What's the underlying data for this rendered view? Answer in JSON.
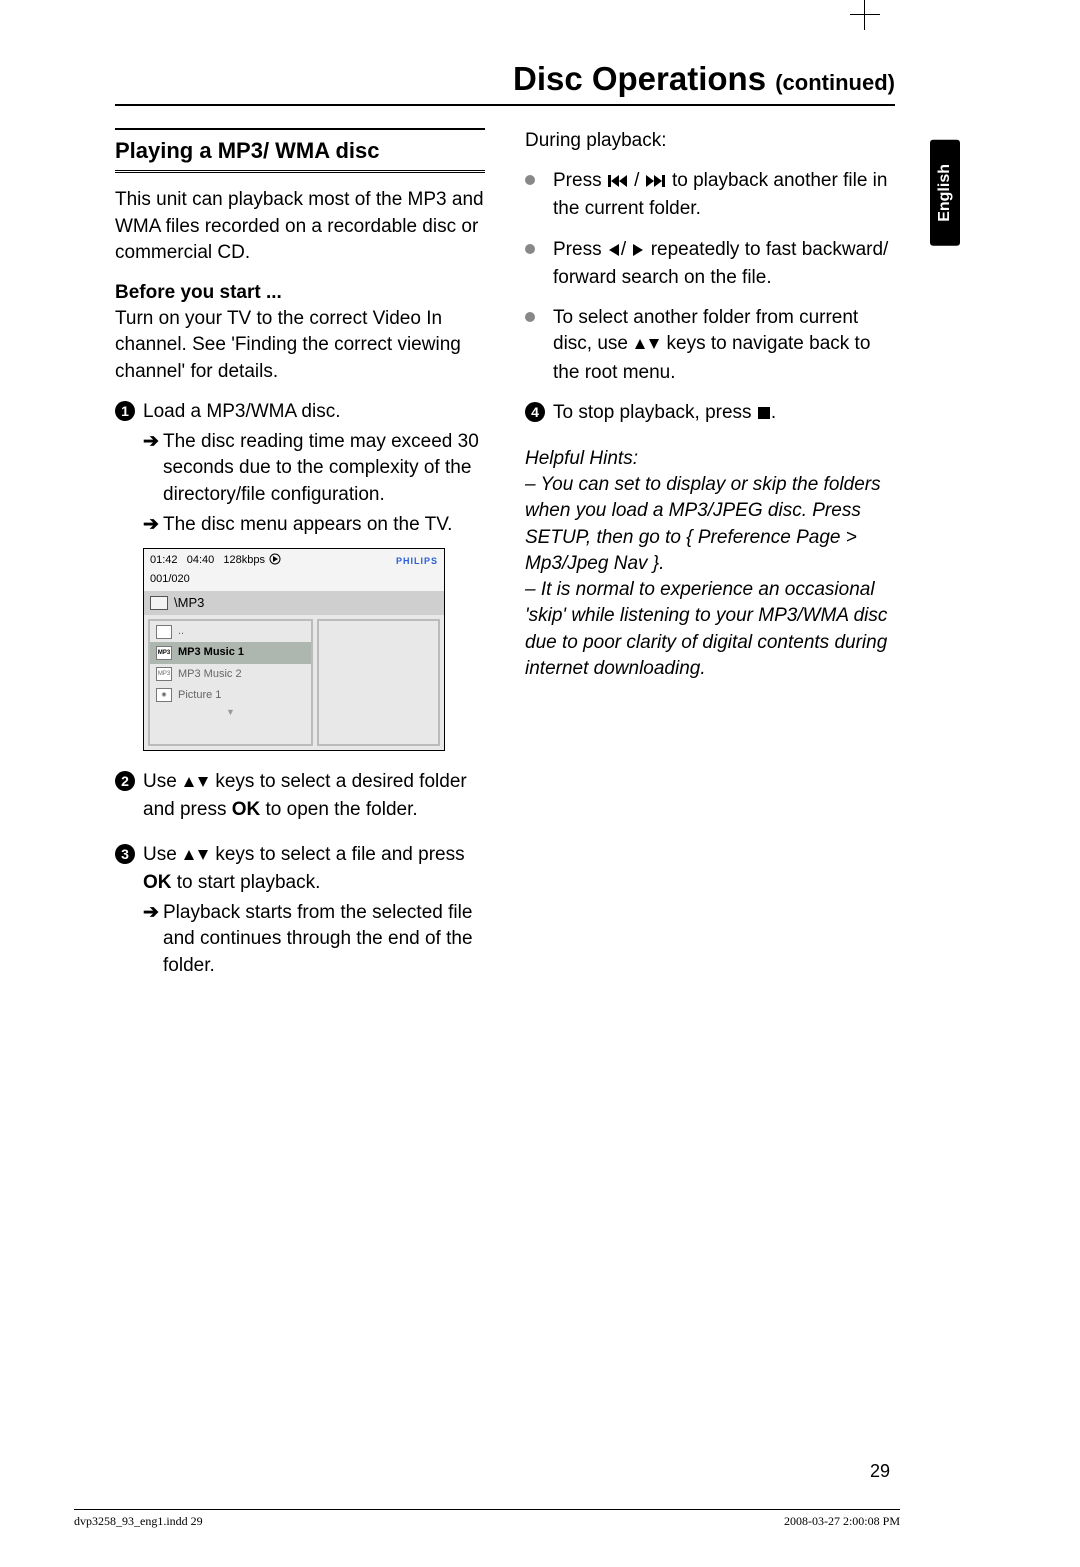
{
  "header": {
    "title": "Disc Operations",
    "continued": "(continued)"
  },
  "langTab": "English",
  "left": {
    "sectionHead": "Playing a MP3/ WMA disc",
    "intro": "This unit can playback most of the MP3 and WMA files recorded on a recordable disc or commercial CD.",
    "beforeLabel": "Before you start ...",
    "beforeText": "Turn on your TV to the correct Video In channel. See 'Finding the correct viewing channel' for details.",
    "step1": "Load a MP3/WMA disc.",
    "step1a": "The disc reading time may exceed 30 seconds due to the complexity of the directory/file configuration.",
    "step1b": "The disc menu appears on the TV.",
    "step2pre": "Use ",
    "step2post": " keys to select a desired folder and press ",
    "step2ok": "OK",
    "step2tail": " to open the folder.",
    "step3pre": "Use ",
    "step3post": " keys to select a file and press ",
    "step3ok": "OK",
    "step3tail": " to start playback.",
    "step3a": "Playback starts from the selected file and continues through the end of the folder."
  },
  "tv": {
    "time1": "01:42",
    "time2": "04:40",
    "bitrate": "128kbps",
    "brand": "PHILIPS",
    "counter": "001/020",
    "path": "\\MP3",
    "rows": {
      "up": "..",
      "r1": "MP3 Music 1",
      "r2": "MP3 Music 2",
      "r3": "Picture 1"
    }
  },
  "right": {
    "during": "During playback:",
    "b1pre": "Press  ",
    "b1post": " to playback another file in the current folder.",
    "b2pre": "Press ",
    "b2post": " repeatedly to fast backward/ forward search on the file.",
    "b3pre": "To select another folder from current disc, use ",
    "b3post": " keys to navigate back to the root menu.",
    "step4pre": "To stop playback, press ",
    "step4post": ".",
    "hintsLabel": "Helpful Hints:",
    "hint1": "–  You can set to display or skip the folders when you load a MP3/JPEG disc. Press SETUP, then go to { Preference Page > Mp3/Jpeg Nav }.",
    "hint2": "–  It is normal to experience an occasional 'skip' while listening to your MP3/WMA disc due to poor clarity of digital contents during internet downloading."
  },
  "pageNumber": "29",
  "footer": {
    "file": "dvp3258_93_eng1.indd   29",
    "stamp": "2008-03-27   2:00:08 PM"
  }
}
